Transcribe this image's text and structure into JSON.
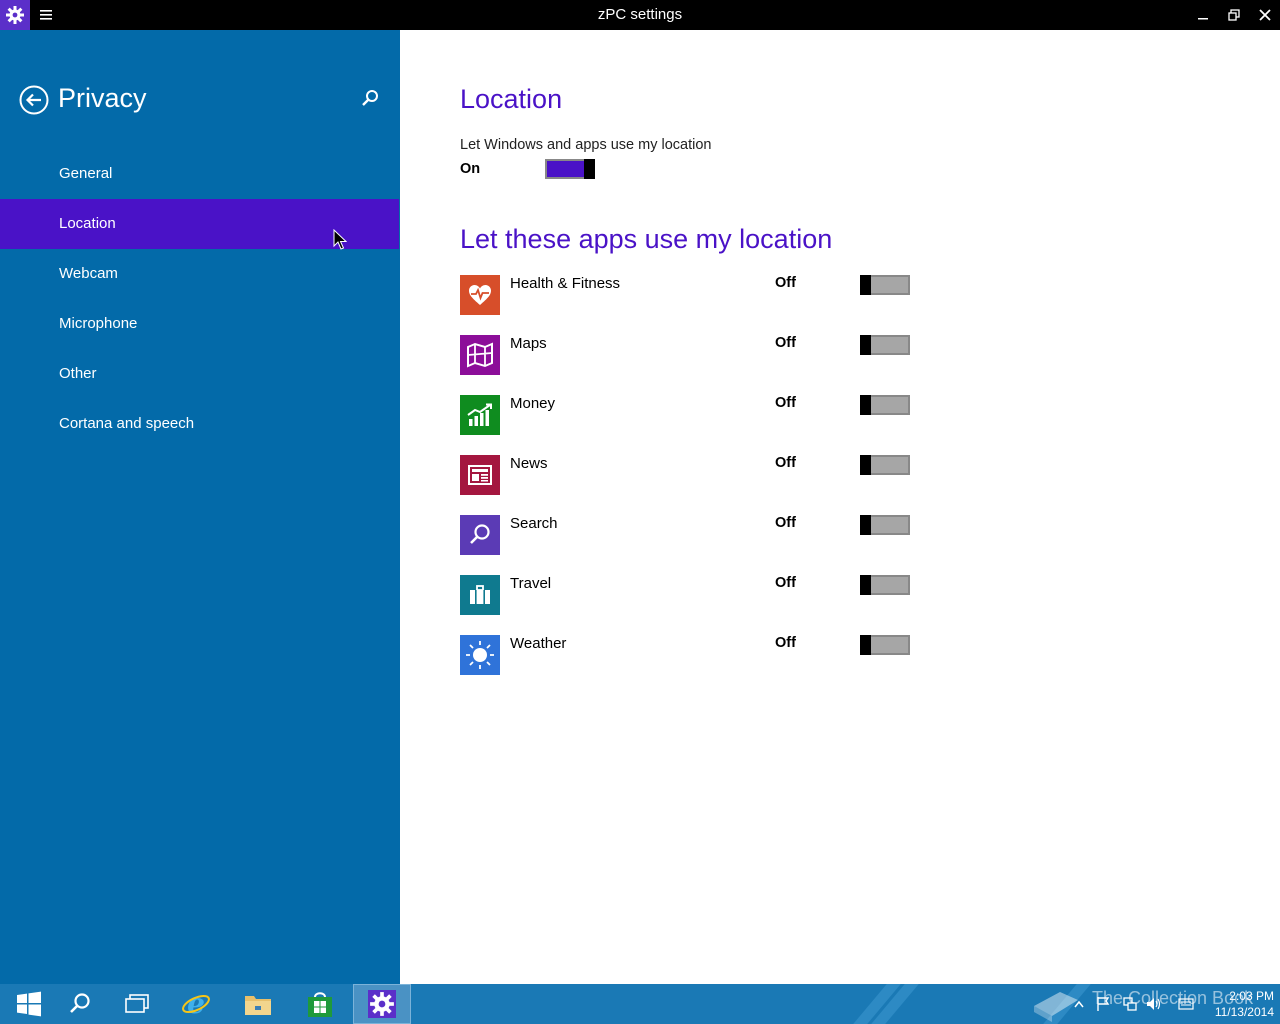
{
  "window": {
    "title": "zPC settings"
  },
  "sidebar": {
    "title": "Privacy",
    "items": [
      {
        "label": "General",
        "selected": false
      },
      {
        "label": "Location",
        "selected": true
      },
      {
        "label": "Webcam",
        "selected": false
      },
      {
        "label": "Microphone",
        "selected": false
      },
      {
        "label": "Other",
        "selected": false
      },
      {
        "label": "Cortana and speech",
        "selected": false
      }
    ]
  },
  "main": {
    "heading": "Location",
    "master_toggle": {
      "label": "Let Windows and apps use my location",
      "state": "On"
    },
    "apps_heading": "Let these apps use my location",
    "apps": [
      {
        "name": "Health & Fitness",
        "state": "Off",
        "icon": "heart-pulse-icon",
        "color": "#d74e2a"
      },
      {
        "name": "Maps",
        "state": "Off",
        "icon": "map-icon",
        "color": "#8c0e99"
      },
      {
        "name": "Money",
        "state": "Off",
        "icon": "chart-up-icon",
        "color": "#0f8c1f"
      },
      {
        "name": "News",
        "state": "Off",
        "icon": "newspaper-icon",
        "color": "#a4163f"
      },
      {
        "name": "Search",
        "state": "Off",
        "icon": "search-icon",
        "color": "#5b3bb5"
      },
      {
        "name": "Travel",
        "state": "Off",
        "icon": "suitcase-icon",
        "color": "#0f7a8f"
      },
      {
        "name": "Weather",
        "state": "Off",
        "icon": "sun-icon",
        "color": "#2f73d9"
      }
    ]
  },
  "colors": {
    "accent": "#4a12c7",
    "sidebar_bg": "#036aa9",
    "taskbar_bg": "#1a79b5",
    "titlebar_bg": "#000000"
  },
  "taskbar": {
    "clock_time": "2:03 PM",
    "clock_date": "11/13/2014",
    "watermark": "The Collection Book"
  }
}
